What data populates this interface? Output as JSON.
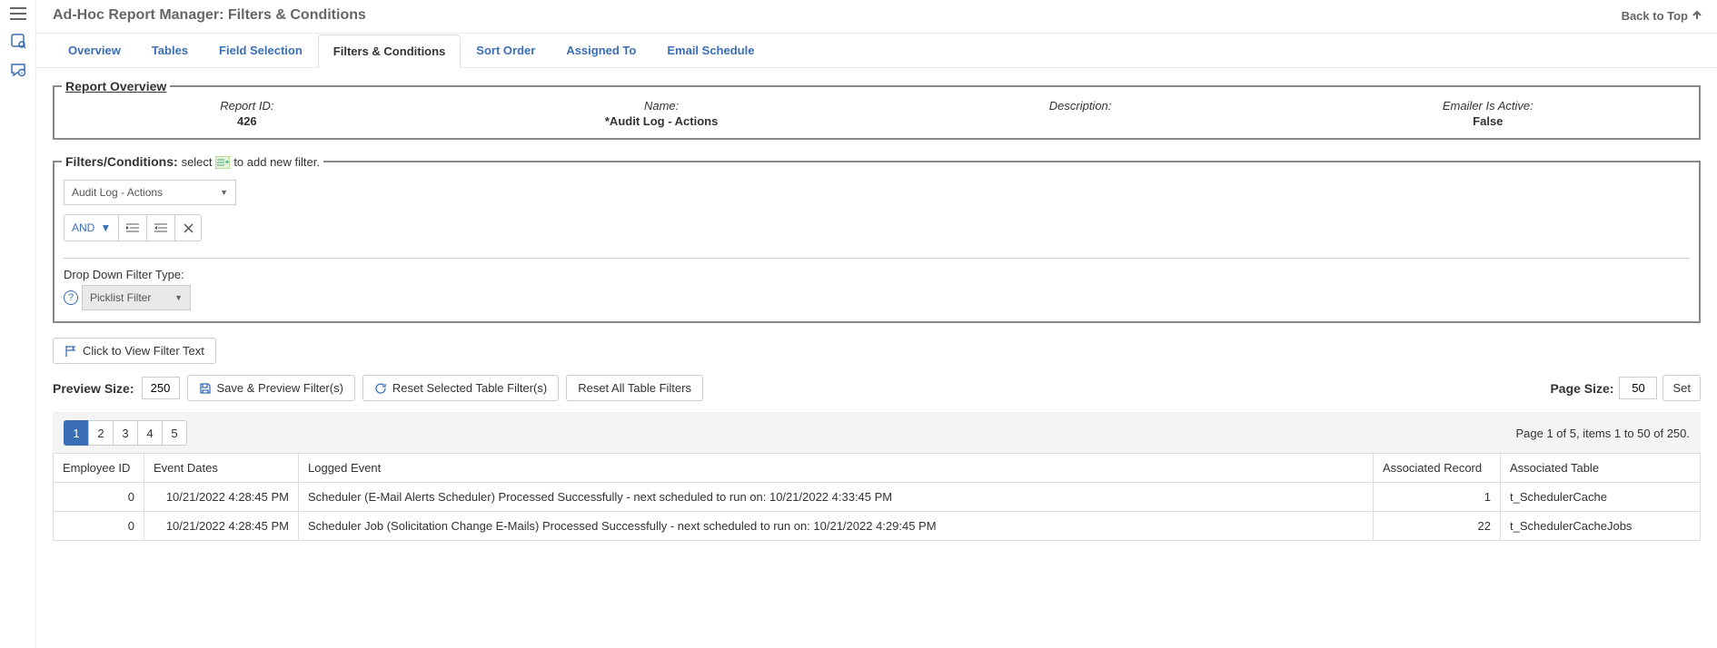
{
  "header": {
    "title": "Ad-Hoc Report Manager: Filters & Conditions",
    "back_to_top": "Back to Top"
  },
  "tabs": [
    {
      "label": "Overview"
    },
    {
      "label": "Tables"
    },
    {
      "label": "Field Selection"
    },
    {
      "label": "Filters & Conditions"
    },
    {
      "label": "Sort Order"
    },
    {
      "label": "Assigned To"
    },
    {
      "label": "Email Schedule"
    }
  ],
  "active_tab_index": 3,
  "overview": {
    "legend": "Report Overview",
    "items": [
      {
        "label": "Report ID:",
        "value": "426"
      },
      {
        "label": "Name:",
        "value": "*Audit Log - Actions"
      },
      {
        "label": "Description:",
        "value": ""
      },
      {
        "label": "Emailer Is Active:",
        "value": "False"
      }
    ]
  },
  "filters": {
    "legend_prefix": "Filters/Conditions:",
    "legend_suffix": "select",
    "legend_suffix2": "to add new filter.",
    "source_dd": "Audit Log - Actions",
    "operator": "AND",
    "ddft_label": "Drop Down Filter Type:",
    "ddft_value": "Picklist Filter"
  },
  "toolbar": {
    "view_filter_text": "Click to View Filter Text",
    "preview_size_label": "Preview Size:",
    "preview_size_value": "250",
    "save_preview": "Save & Preview Filter(s)",
    "reset_selected": "Reset Selected Table Filter(s)",
    "reset_all": "Reset All Table Filters",
    "page_size_label": "Page Size:",
    "page_size_value": "50",
    "set_btn": "Set"
  },
  "pager": {
    "pages": [
      "1",
      "2",
      "3",
      "4",
      "5"
    ],
    "active_index": 0,
    "info": "Page 1 of 5, items 1 to 50 of 250."
  },
  "table": {
    "headers": [
      "Employee ID",
      "Event Dates",
      "Logged Event",
      "Associated Record",
      "Associated Table"
    ],
    "rows": [
      {
        "emp": "0",
        "date": "10/21/2022 4:28:45 PM",
        "event": "Scheduler (E-Mail Alerts Scheduler) Processed Successfully - next scheduled to run on: 10/21/2022 4:33:45 PM",
        "rec": "1",
        "tbl": "t_SchedulerCache"
      },
      {
        "emp": "0",
        "date": "10/21/2022 4:28:45 PM",
        "event": "Scheduler Job (Solicitation Change E-Mails) Processed Successfully - next scheduled to run on: 10/21/2022 4:29:45 PM",
        "rec": "22",
        "tbl": "t_SchedulerCacheJobs"
      }
    ]
  }
}
